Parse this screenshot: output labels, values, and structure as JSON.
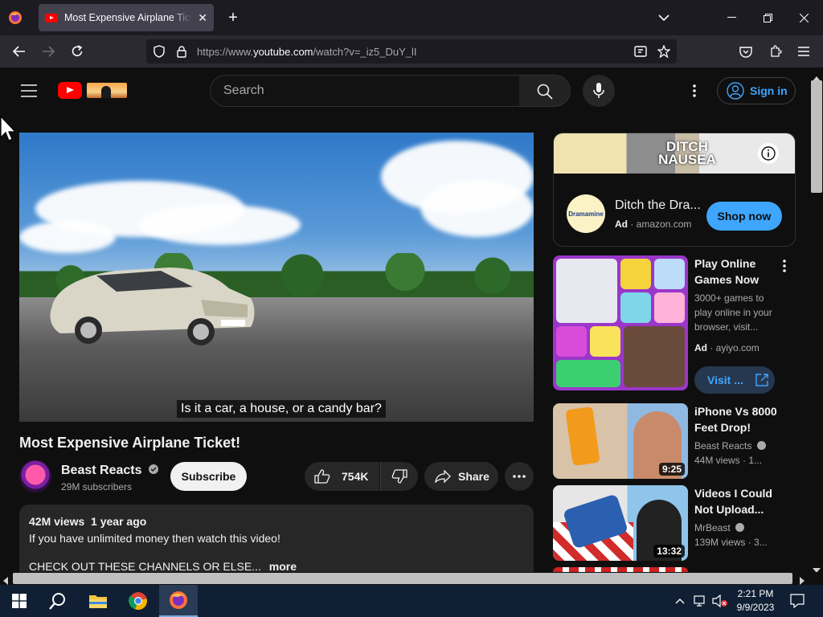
{
  "browser": {
    "tab_title": "Most Expensive Airplane Ticket!",
    "url_prefix": "https://www.",
    "url_domain": "youtube.com",
    "url_suffix": "/watch?v=_iz5_DuY_lI"
  },
  "youtube": {
    "search_placeholder": "Search",
    "sign_in_label": "Sign in",
    "caption": "Is it a car, a house, or a candy bar?",
    "video_title": "Most Expensive Airplane Ticket!",
    "channel_name": "Beast Reacts",
    "subscribers": "29M subscribers",
    "subscribe_label": "Subscribe",
    "likes": "754K",
    "share_label": "Share",
    "views": "42M views",
    "age": "1 year ago",
    "description_line1": "If you have unlimited money then watch this video!",
    "description_line2": "CHECK OUT THESE CHANNELS OR ELSE...",
    "more_label": "more"
  },
  "sidebar": {
    "ad1": {
      "brand_badge": "Dramamine",
      "title": "Ditch the Dra...",
      "ad_label": "Ad",
      "domain": "amazon.com",
      "cta": "Shop now",
      "banner_text": "DITCH NAUSEA"
    },
    "ad2": {
      "title": "Play Online Games Now",
      "description": "3000+ games to play online in your browser, visit...",
      "ad_label": "Ad",
      "domain": "ayiyo.com",
      "cta": "Visit ..."
    },
    "videos": [
      {
        "title": "iPhone Vs 8000 Feet Drop!",
        "channel": "Beast Reacts",
        "meta": "44M views · 1...",
        "duration": "9:25"
      },
      {
        "title": "Videos I Could Not Upload...",
        "channel": "MrBeast",
        "meta": "139M views · 3...",
        "duration": "13:32"
      }
    ]
  },
  "taskbar": {
    "time": "2:21 PM",
    "date": "9/9/2023"
  }
}
